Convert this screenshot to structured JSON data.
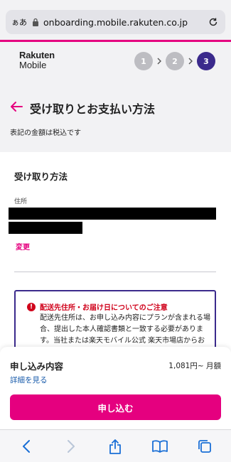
{
  "browser": {
    "aa_label": "ぁあ",
    "url": "onboarding.mobile.rakuten.co.jp"
  },
  "header": {
    "logo_line1": "Rakuten",
    "logo_line2": "Mobile",
    "steps": [
      "1",
      "2",
      "3"
    ],
    "active_step": 3
  },
  "page": {
    "title": "受け取りとお支払い方法",
    "tax_note": "表記の金額は税込です"
  },
  "delivery": {
    "section_title": "受け取り方法",
    "address_label": "住所",
    "change_link": "変更"
  },
  "notice": {
    "icon": "!",
    "title": "配送先住所・お届け日についてのご注意",
    "body": "配送先住所は、お申し込み内容にプランが含まれる場合、提出した本人確認書類と一致する必要があります。当社または楽天モバイル公式 楽天市場店からお申"
  },
  "summary": {
    "title": "申し込み内容",
    "price": "1,081円~ 月額",
    "detail_link": "詳細を見る",
    "apply_button": "申し込む"
  },
  "colors": {
    "brand_pink": "#e5007f",
    "step_active": "#3b2a8c",
    "step_inactive": "#bdbdc2",
    "link_blue": "#1a5cab",
    "warning_red": "#d0021b"
  },
  "icons": {
    "lock": "lock-icon",
    "reload": "reload-icon",
    "back": "back-arrow-icon",
    "nav_back": "chevron-left-icon",
    "nav_forward": "chevron-right-icon",
    "share": "share-icon",
    "bookmarks": "bookmarks-icon",
    "tabs": "tabs-icon"
  }
}
